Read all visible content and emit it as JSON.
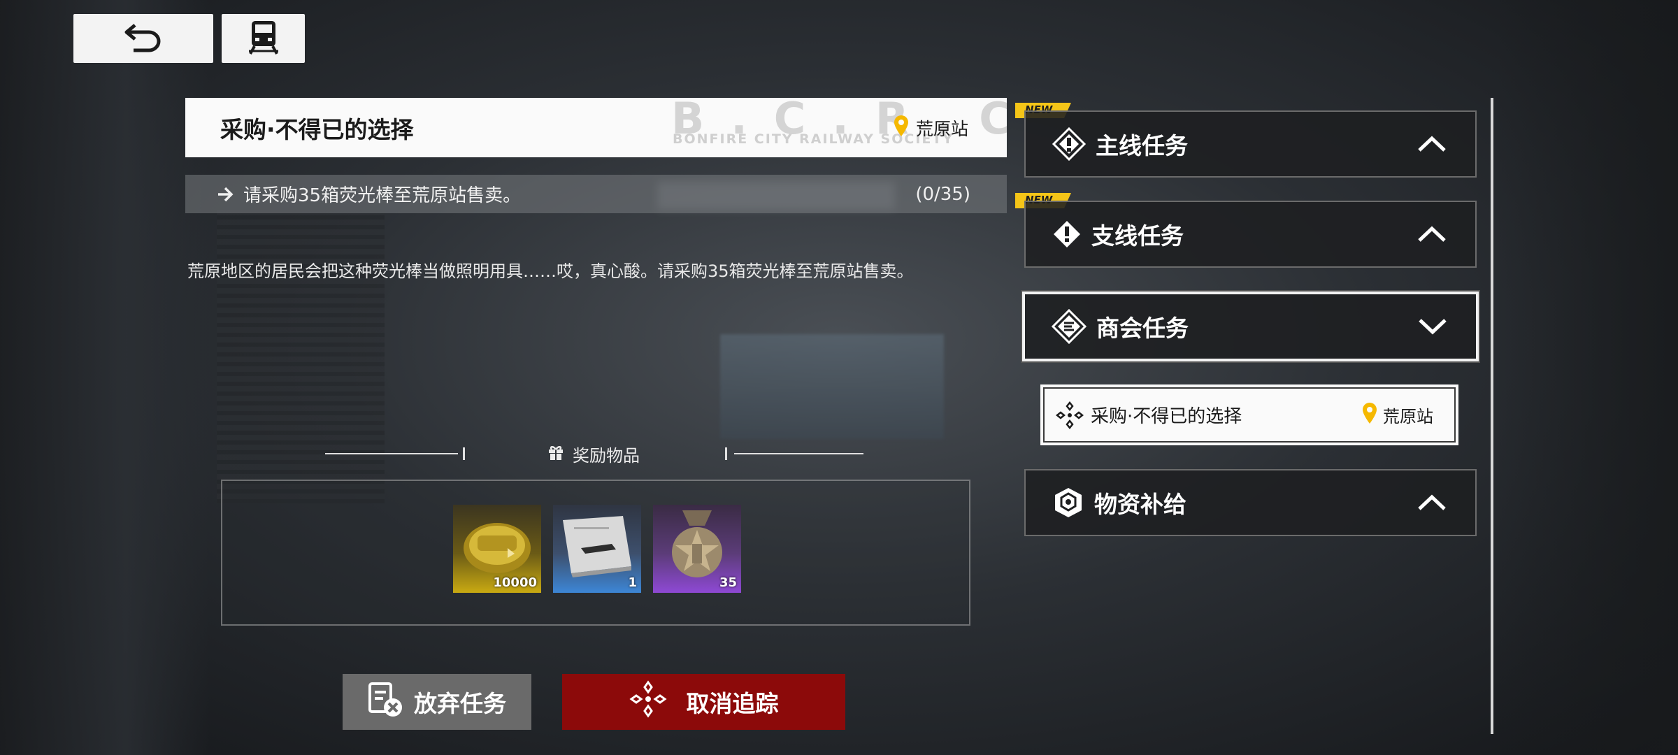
{
  "top_bar": {
    "back_icon": "back-arrow-icon",
    "train_icon": "train-icon"
  },
  "quest": {
    "title": "采购·不得已的选择",
    "watermark": "B.C.R.C",
    "watermark_sub": "BONFIRE CITY RAILWAY SOCIETY",
    "location": "荒原站",
    "objective": "请采购35箱荧光棒至荒原站售卖。",
    "progress": "(0/35)",
    "description": "荒原地区的居民会把这种荧光棒当做照明用具……哎，真心酸。请采购35箱荧光棒至荒原站售卖。"
  },
  "rewards": {
    "header": "奖励物品",
    "items": [
      {
        "name": "gold-currency",
        "qty": "10000",
        "color": "#c9aa12"
      },
      {
        "name": "train-blueprint",
        "qty": "1",
        "color": "#3d86d6"
      },
      {
        "name": "bronze-medal",
        "qty": "35",
        "color": "#8e49d4"
      }
    ]
  },
  "actions": {
    "abandon": "放弃任务",
    "untrack": "取消追踪"
  },
  "categories": {
    "new_badge": "NEW",
    "main": "主线任务",
    "side": "支线任务",
    "trade": "商会任务",
    "supply": "物资补给"
  },
  "trade_quest": {
    "title": "采购·不得已的选择",
    "location": "荒原站"
  },
  "colors": {
    "untrack_red": "#8c0a0a",
    "new_yellow": "#f5c518",
    "location_pin": "#f5b800"
  }
}
